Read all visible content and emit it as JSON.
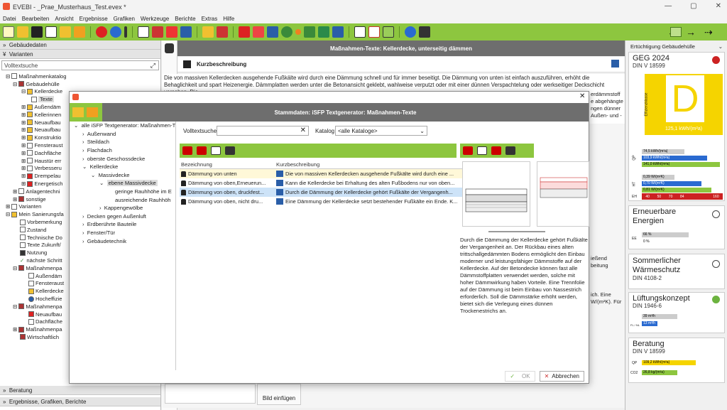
{
  "window": {
    "title": "EVEBI - _Prae_Musterhaus_Test.evex *",
    "min": "—",
    "max": "▢",
    "close": "✕"
  },
  "menu": [
    "Datei",
    "Bearbeiten",
    "Ansicht",
    "Ergebnisse",
    "Grafiken",
    "Werkzeuge",
    "Berichte",
    "Extras",
    "Hilfe"
  ],
  "top_right": {
    "dropdown": "Ertüchtigung Gebäudehülle",
    "back": "←",
    "fwd": "→",
    "more": "⇢"
  },
  "left": {
    "gebaeudedaten": "Gebäudedaten",
    "varianten": "Varianten",
    "search_placeholder": "Volltextsuche",
    "tree": [
      "Maßnahmenkatalog",
      "Gebäudehülle",
      "Kellerdecke",
      "Texte",
      "Außendäm",
      "Kellerinnen",
      "Neuaufbau",
      "Neuaufbau",
      "Konstruktio",
      "Fensteraust",
      "Dachfläche",
      "Haustür err",
      "Verbesseru",
      "Drempelau",
      "Energetisch",
      "Anlagentechni",
      "sonstige",
      "Varianten",
      "Mein Sanierungsfa",
      "Vorbemerkung",
      "Zustand",
      "Technische Do",
      "Texte Zukunft/",
      "Nutzung",
      "nächste Schritt",
      "Maßnahmenpa",
      "Außendäm",
      "Fensteraust",
      "Kellerdecke",
      "Hocheffizie",
      "Maßnahmenpa",
      "Neuaufbau",
      "Dachfläche",
      "Maßnahmenpa",
      "Wirtschaftlich"
    ],
    "beratung": "Beratung",
    "ergebnisse": "Ergebnisse, Grafiken, Berichte"
  },
  "main": {
    "title": "Maßnahmen-Texte: Kellerdecke, unterseitig dämmen",
    "kurz": "Kurzbeschreibung",
    "desc": "Die von massiven Kellerdecken ausgehende Fußkälte wird durch eine Dämmung schnell und für immer beseitigt. Die Dämmung von unten ist einfach auszuführen, erhöht die Behaglichkeit und spart Heizenergie. Dämmplatten werden unter die Betonansicht geklebt, wahlweise verputzt oder mit einer dünnen Verspachtelung oder werkseitiger Deckschicht versehen. Die",
    "behind": [
      "erdämmstoff",
      "e abgehängte",
      "ngen dünner",
      "Außen- und -",
      "ießend",
      "beitung",
      "ich. Eine",
      "W/(m²K). Für"
    ],
    "bild": "Bild einfügen"
  },
  "right": {
    "geg": {
      "title": "GEG 2024",
      "sub": "DIN V 18599",
      "grade": "D",
      "value": "125,1 kWh/(m²a)",
      "effizienz": "Effizienzklasse",
      "bars1": [
        "74,5 kWh/(m²a)",
        "103,9 kWh/(m²a)",
        "141,0 kWh/(m²a)"
      ],
      "bars2": [
        "0,39 W/(m²K)",
        "0,70 W/(m²K)",
        "0,81 W/(m²K)"
      ],
      "scale": [
        "40",
        "50",
        "70",
        "84",
        "160"
      ],
      "lab1": "QP",
      "lab2": "HT",
      "lab3": "EH"
    },
    "ee": {
      "title": "Erneuerbare Energien",
      "b1": "66 %",
      "b2": "0 %",
      "lab": "EE"
    },
    "sw": {
      "title": "Sommerlicher Wärmeschutz",
      "sub": "DIN 4108-2"
    },
    "lk": {
      "title": "Lüftungskonzept",
      "sub": "DIN 1946-6",
      "b1": "39 m³/h",
      "b2": "13 m³/h",
      "lab": "FL / NL"
    },
    "ber": {
      "title": "Beratung",
      "sub": "DIN V 18599",
      "b1": "109,2 kWh/(m²a)",
      "b2": "26,8 kg/(m²a)",
      "lab1": "QP",
      "lab2": "CO2"
    },
    "colors": {
      "red": "#cc2222",
      "green": "#6cb33f",
      "yellow": "#f5d400"
    }
  },
  "dialog": {
    "title": "Stammdaten: iSFP Textgenerator: Maßnahmen-Texte",
    "search_label": "Volltextsuche",
    "catalog_label": "Katalog",
    "catalog_value": "<alle Kataloge>",
    "tree": [
      "alle iSFP Textgenerator: Maßnahmen-T",
      "Außenwand",
      "Steildach",
      "Flachdach",
      "oberste Geschossdecke",
      "Kellerdecke",
      "Massivdecke",
      "ebene Massivdecke",
      "geringe Rauhhöhe im E",
      "ausreichende Rauhhöh",
      "Kappengewölbe",
      "Decken gegen Außenluft",
      "Erdberührte Bauteile",
      "Fenster/Tür",
      "Gebäudetechnik"
    ],
    "col1": "Bezeichnung",
    "col2": "Kurzbeschreibung",
    "rows": [
      {
        "name": "Dämmung von unten",
        "desc": "Die von massiven Kellerdecken ausgehende Fußkälte wird durch eine ..."
      },
      {
        "name": "Dämmung von oben,Erneuerun...",
        "desc": "Kann die Kellerdecke bei Erhaltung des alten Fußbodens nur von oben..."
      },
      {
        "name": "Dämmung von oben, druckfest...",
        "desc": "Durch die Dämmung der Kellerdecke gehört Fußkälte der Vergangenh..."
      },
      {
        "name": "Dämmung von oben, nicht dru...",
        "desc": "Eine Dämmung der Kellerdecke setzt bestehender Fußkälte ein Ende. K..."
      }
    ],
    "preview": "Durch die Dämmung der Kellerdecke gehört Fußkälte der Vergangenheit an. Der Rückbau eines alten trittschallgedämmten Bodens ermöglicht den Einbau moderner und leistungsfähiger Dämmstoffe auf der Kellerdecke. Auf der Betondecke können fast alle Dämmstoffplatten verwendet werden, solche mit hoher Dämmwirkung haben Vorteile. Eine Trennfolie auf der Dämmung ist beim Einbau von Nassestrich erforderlich. Soll die Dämmstärke erhöht werden, bietet sich die Verlegung eines dünnen Trockenestrichs an.",
    "ok": "OK",
    "cancel": "Abbrechen",
    "close": "✕"
  }
}
